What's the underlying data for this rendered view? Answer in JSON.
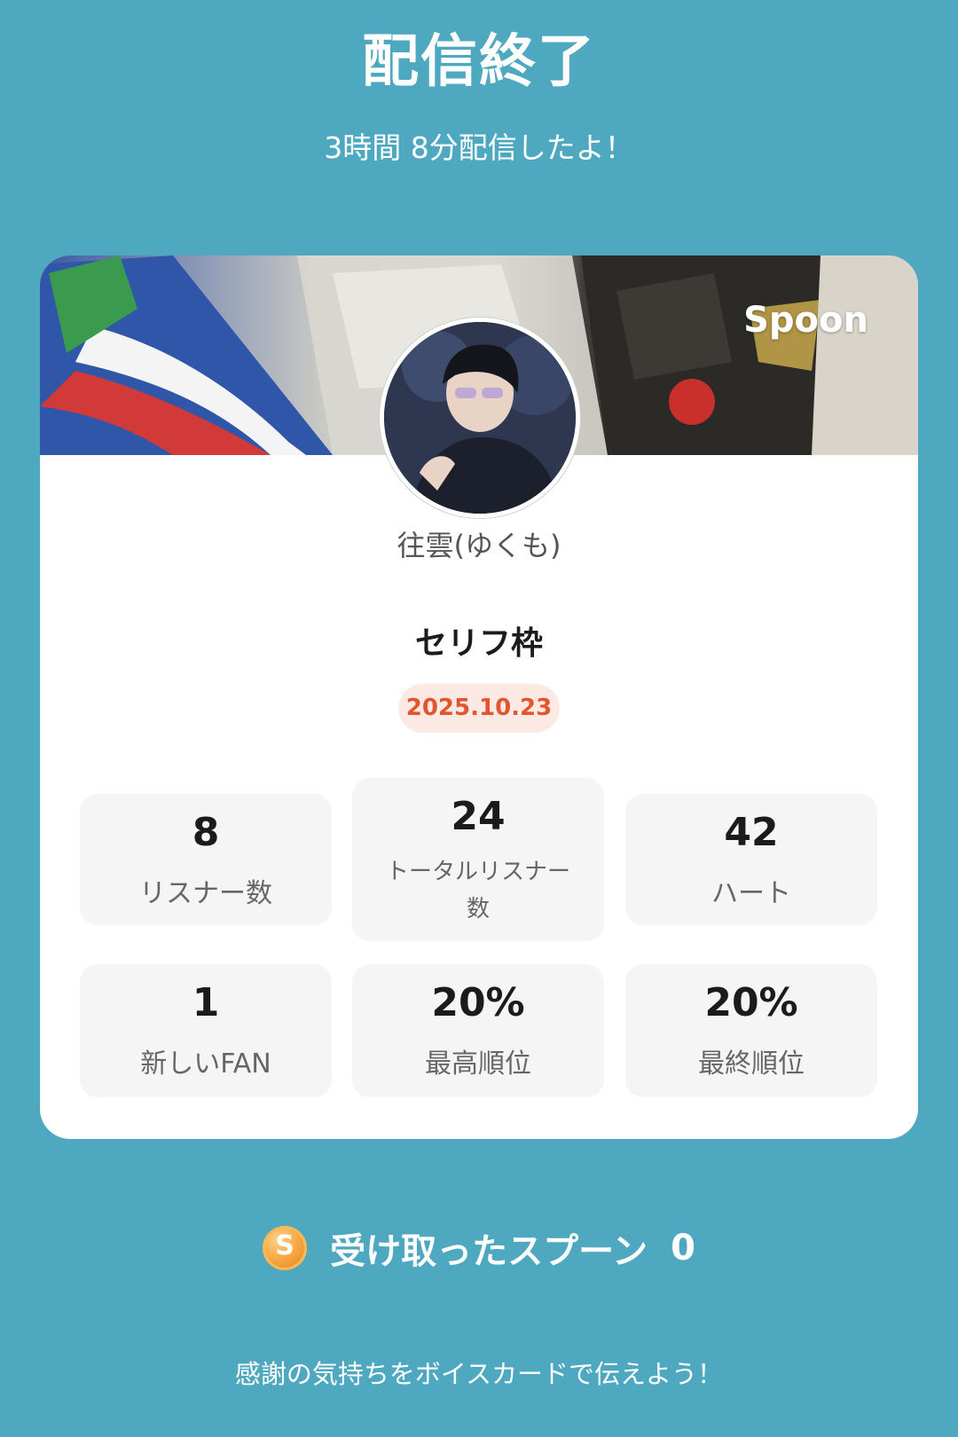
{
  "header": {
    "title": "配信終了",
    "subtitle": "3時間 8分配信したよ！"
  },
  "card": {
    "brand": "Spoon",
    "username": "往雲(ゆくも)",
    "live_title": "セリフ枠",
    "date": "2025.10.23"
  },
  "stats": [
    {
      "value": "8",
      "label": "リスナー数"
    },
    {
      "value": "24",
      "label_line1": "トータルリスナー",
      "label_line2": "数"
    },
    {
      "value": "42",
      "label": "ハート"
    },
    {
      "value": "1",
      "label": "新しいFAN"
    },
    {
      "value": "20%",
      "label": "最高順位"
    },
    {
      "value": "20%",
      "label": "最終順位"
    }
  ],
  "spoons": {
    "coin_letter": "S",
    "label": "受け取ったスプーン",
    "count": "0"
  },
  "footer": {
    "message": "感謝の気持ちをボイスカードで伝えよう！"
  },
  "colors": {
    "background": "#4ea8c0",
    "date_badge_text": "#e3552e",
    "date_badge_bg": "#fde9e3",
    "coin": "#f5a23a"
  },
  "icons": {
    "coin": "spoon-coin-icon"
  }
}
